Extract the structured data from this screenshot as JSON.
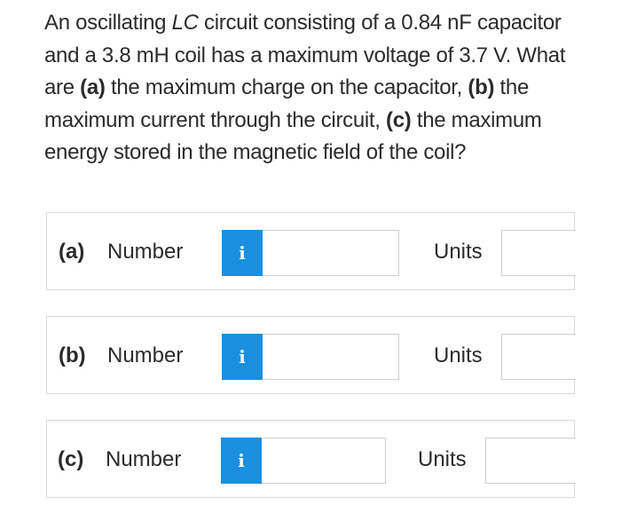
{
  "question": {
    "t1": "An oscillating ",
    "t2": "LC",
    "t3": " circuit consisting of a 0.84 nF capacitor and a 3.8 mH coil has a maximum voltage of 3.7 V. What are ",
    "t4": "(a)",
    "t5": " the maximum charge on the capacitor, ",
    "t6": "(b)",
    "t7": " the maximum current through the circuit, ",
    "t8": "(c)",
    "t9": " the maximum energy stored in the magnetic field of the coil?"
  },
  "answers": [
    {
      "tag": "(a)",
      "number_label": "Number",
      "info_icon_text": "i",
      "number_value": "",
      "units_label": "Units",
      "units_value": ""
    },
    {
      "tag": "(b)",
      "number_label": "Number",
      "info_icon_text": "i",
      "number_value": "",
      "units_label": "Units",
      "units_value": ""
    },
    {
      "tag": "(c)",
      "number_label": "Number",
      "info_icon_text": "i",
      "number_value": "",
      "units_label": "Units",
      "units_value": ""
    }
  ],
  "colors": {
    "info_button": "#1a8fe0",
    "text": "#2b2b2b",
    "border": "#d9d9d9"
  },
  "icons": {
    "info": "info-icon"
  }
}
